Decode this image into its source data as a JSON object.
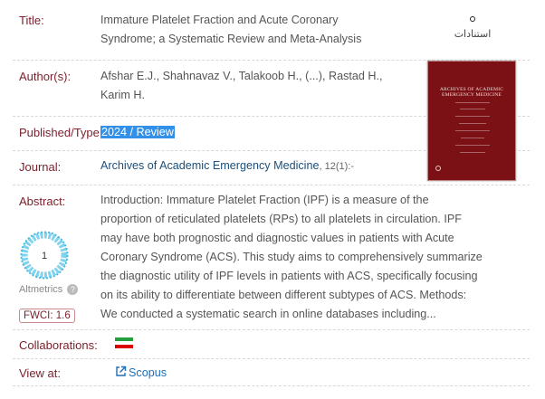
{
  "labels": {
    "title": "Title:",
    "authors": "Author(s):",
    "published": "Published/Type:",
    "journal": "Journal:",
    "abstract": "Abstract:",
    "collaborations": "Collaborations:",
    "view_at": "View at:"
  },
  "title_line1": "Immature Platelet Fraction and Acute Coronary",
  "title_line2": "Syndrome; a Systematic Review and Meta-Analysis",
  "authors_line1": "Afshar E.J., Shahnavaz V., Talakoob H., (...), Rastad H.,",
  "authors_line2": "Karim H.",
  "published": "2024 / Review",
  "journal": {
    "name": "Archives of Academic Emergency Medicine",
    "ref": ", 12(1):-"
  },
  "abstract_lines": [
    "Introduction: Immature Platelet Fraction (IPF) is a measure of the",
    "proportion of reticulated platelets (RPs) to all platelets in circulation. IPF",
    "may have both prognostic and diagnostic values in patients with Acute",
    "Coronary Syndrome (ACS). This study aims to comprehensively summarize",
    "the diagnostic utility of IPF levels in patients with ACS, specifically focusing",
    "on its ability to differentiate between different subtypes of ACS. Methods:",
    "We conducted a systematic search in online databases including..."
  ],
  "istinad": "استنادات",
  "altmetric": {
    "score": "1",
    "label": "Altmetrics",
    "help": "?"
  },
  "fwci": "FWCI: 1.6",
  "view_at": "Scopus",
  "cover": {
    "title_line1": "ARCHIVES OF ACADEMIC",
    "title_line2": "EMERGENCY MEDICINE"
  },
  "colors": {
    "label": "#7a1f2b",
    "link": "#1d4f7a",
    "scopus": "#1d6fb8",
    "highlight": "#3390e8",
    "cover": "#7b1114"
  }
}
